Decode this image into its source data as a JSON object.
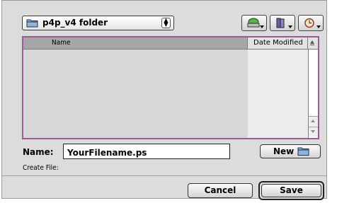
{
  "folder_popup": {
    "label": "p4p_v4 folder",
    "icon": "folder-icon"
  },
  "toolbar": {
    "buttons": [
      {
        "icon": "disk-icon"
      },
      {
        "icon": "books-icon"
      },
      {
        "icon": "clock-icon"
      }
    ]
  },
  "browser": {
    "columns": [
      "Name",
      "Date Modified"
    ],
    "items": []
  },
  "form": {
    "name_label": "Name:",
    "filename_value": "YourFilename.ps",
    "new_button_label": "New",
    "create_file_label": "Create File:"
  },
  "buttons": {
    "cancel": "Cancel",
    "save": "Save"
  },
  "colors": {
    "browser_border": "#9a5a98",
    "header_name_bg": "#a6a6a6",
    "dialog_bg": "#dcdcdc"
  }
}
